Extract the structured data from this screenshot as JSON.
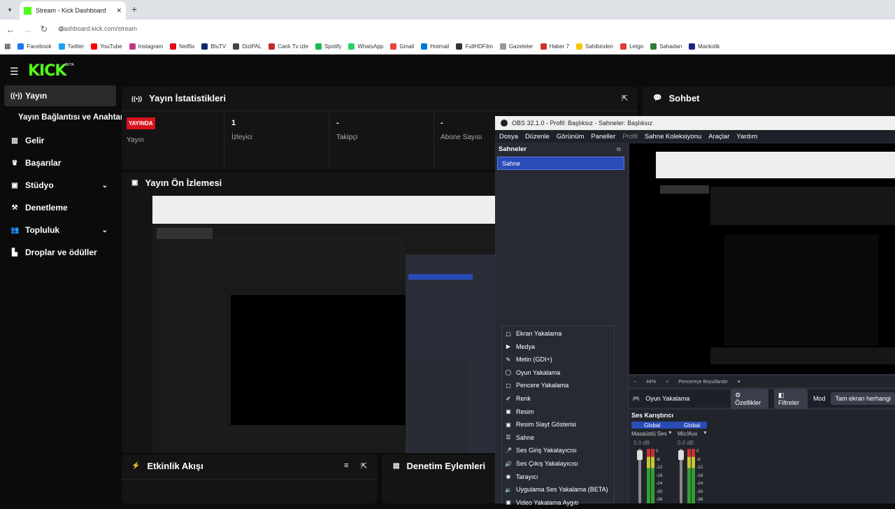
{
  "browser": {
    "tab_title": "Stream - Kick Dashboard",
    "url": "dashboard.kick.com/stream",
    "bookmarks": [
      "Facebook",
      "Twitter",
      "YouTube",
      "Instagram",
      "Netflix",
      "BluTV",
      "DiziPAL",
      "Canlı Tv izle",
      "Spotify",
      "WhatsApp",
      "Gmail",
      "Hotmail",
      "FullHDFilm",
      "Gazeteler",
      "Haber 7",
      "Sahibinden",
      "Letgo",
      "Sahadan",
      "Mackolik"
    ],
    "bookmark_colors": [
      "#1877f2",
      "#1da1f2",
      "#ff0000",
      "#c13584",
      "#e50914",
      "#0a2a6b",
      "#444",
      "#c62828",
      "#1db954",
      "#25d366",
      "#ea4335",
      "#0078d4",
      "#333",
      "#999",
      "#d32f2f",
      "#f7c600",
      "#e53935",
      "#2e7d32",
      "#1a237e"
    ]
  },
  "kick": {
    "logo": "KICK",
    "beta": "BETA",
    "nav": {
      "yayin": "Yayın",
      "baglanti": "Yayın Bağlantısı ve Anahtarı",
      "gelir": "Gelir",
      "basarilar": "Başarılar",
      "studyo": "Stüdyo",
      "denetleme": "Denetleme",
      "topluluk": "Topluluk",
      "droplar": "Droplar ve ödüller"
    },
    "stats": {
      "title": "Yayın İstatistikleri",
      "badge": "YAYINDA",
      "yayin_label": "Yayın",
      "izleyici_value": "1",
      "izleyici_label": "İzleyici",
      "takipci_value": "-",
      "takipci_label": "Takipçi",
      "abone_value": "-",
      "abone_label": "Abone Sayısı"
    },
    "preview_title": "Yayın Ön İzlemesi",
    "chat_title": "Sohbet",
    "activity_title": "Etkinlik Akışı",
    "moderation_title": "Denetim Eylemleri"
  },
  "obs": {
    "title": "OBS 32.1.0 - Profil: Başlıksız - Sahneler: Başlıksız",
    "menu": [
      "Dosya",
      "Düzenle",
      "Görünüm",
      "Paneller",
      "Profil",
      "Sahne Koleksiyonu",
      "Araçlar",
      "Yardım"
    ],
    "scenes_header": "Sahneler",
    "scene_item": "Sahne",
    "context_menu": [
      "Ekran Yakalama",
      "Medya",
      "Metin (GDI+)",
      "Oyun Yakalama",
      "Pencere Yakalama",
      "Renk",
      "Resim",
      "Resim Slayt Gösterisi",
      "Sahne",
      "Ses Giriş Yakalayıcısı",
      "Ses Çıkış Yakalayıcısı",
      "Tarayıcı",
      "Uygulama Ses Yakalama (BETA)",
      "Video Yakalama Aygıtı"
    ],
    "zoom": "44%",
    "zoom_fit": "Pencereye Boyutlandır",
    "source_name": "Oyun Yakalama",
    "properties": "Özellikler",
    "filters": "Filtreler",
    "mode": "Mod",
    "fullscreen": "Tam ekran herhangi",
    "mixer_header": "Ses Karıştırıcı",
    "channels": [
      {
        "scope": "Global",
        "name": "Masaüstü Ses",
        "level": "0.0 dB"
      },
      {
        "scope": "Global",
        "name": "Mic/Aux",
        "level": "0.0 dB"
      }
    ],
    "meter_ticks": [
      "0",
      "-6",
      "-12",
      "-18",
      "-24",
      "-30",
      "-36"
    ]
  }
}
